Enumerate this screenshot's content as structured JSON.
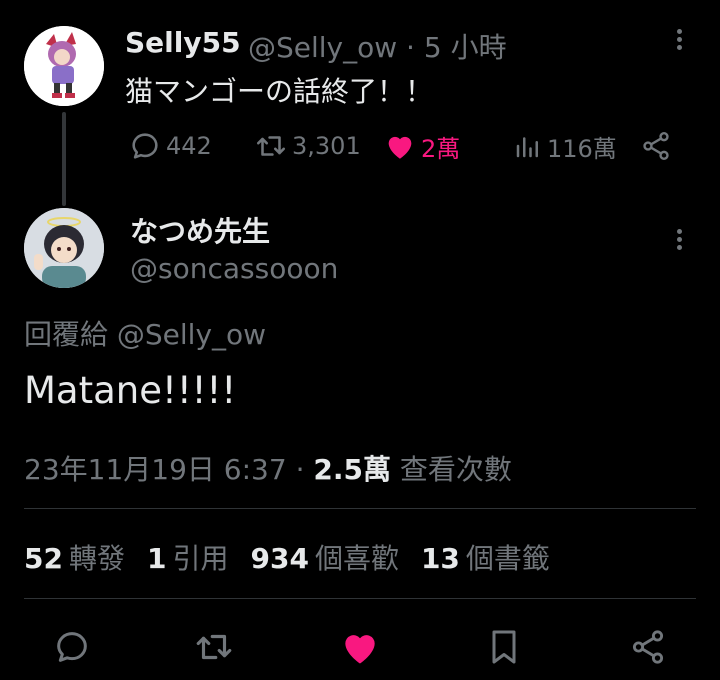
{
  "parent_tweet": {
    "display_name": "Selly55",
    "handle_time": "@Selly_ow · 5 小時",
    "text": "猫マンゴーの話終了！！",
    "stats": {
      "replies": "442",
      "retweets": "3,301",
      "likes": "2萬",
      "views": "116萬"
    }
  },
  "reply_tweet": {
    "display_name": "なつめ先生",
    "handle": "@soncassooon",
    "replying_to": "回覆給 @Selly_ow",
    "text": "Matane!!!!!",
    "timestamp": "23年11月19日 6:37 · ",
    "views_count": "2.5萬",
    "views_label": " 查看次數",
    "counts": {
      "retweets_num": "52",
      "retweets_label": "轉發",
      "quotes_num": "1",
      "quotes_label": "引用",
      "likes_num": "934",
      "likes_label": "個喜歡",
      "bookmarks_num": "13",
      "bookmarks_label": "個書籤"
    }
  },
  "colors": {
    "background": "#000000",
    "text": "#e7e9ea",
    "muted": "#71767b",
    "like": "#f91880",
    "divider": "#2f3336"
  },
  "icons": [
    "reply-icon",
    "retweet-icon",
    "heart-icon",
    "views-icon",
    "share-icon",
    "bookmark-icon",
    "more-icon"
  ]
}
